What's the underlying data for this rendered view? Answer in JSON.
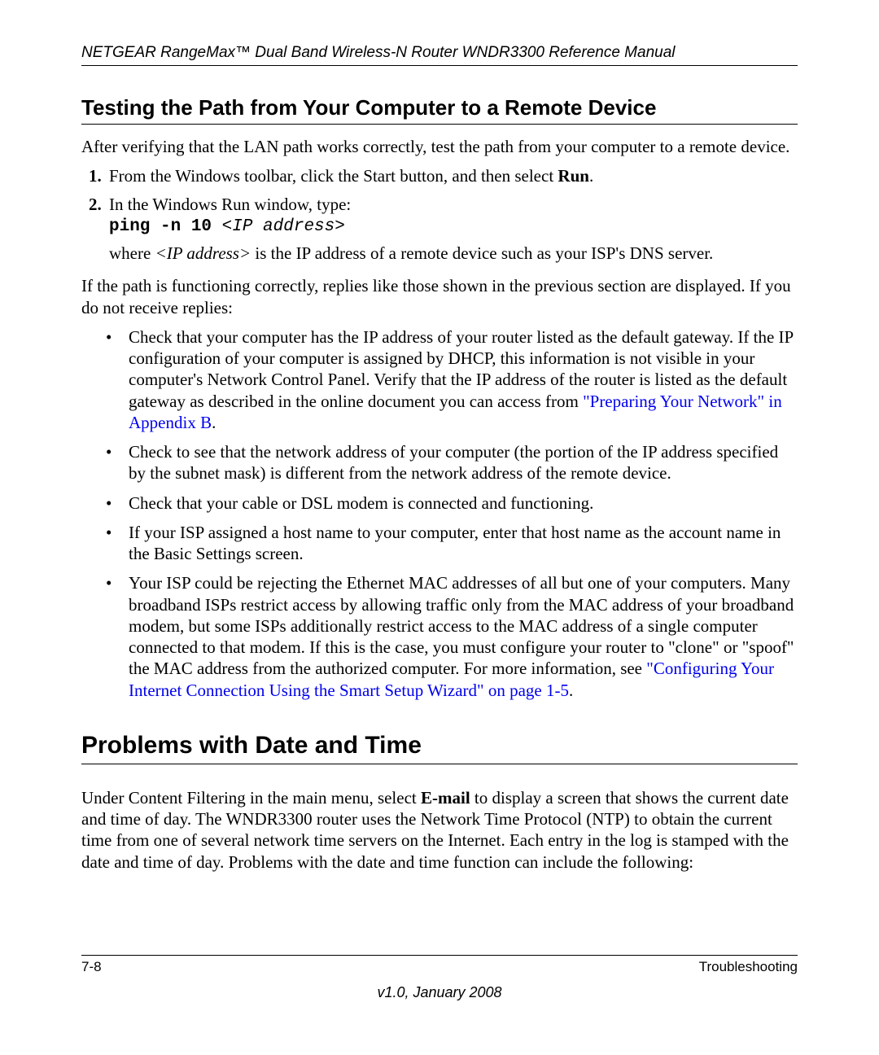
{
  "header": {
    "running": "NETGEAR RangeMax™ Dual Band Wireless-N Router WNDR3300 Reference Manual"
  },
  "section1": {
    "heading": "Testing the Path from Your Computer to a Remote Device",
    "intro": "After verifying that the LAN path works correctly, test the path from your computer to a remote device.",
    "steps": {
      "s1_a": "From the Windows toolbar, click the Start button, and then select ",
      "s1_b": "Run",
      "s1_c": ".",
      "s2_a": "In the Windows Run window, type:",
      "s2_code_bold": "ping -n 10 ",
      "s2_code_ital": "<IP address>",
      "s2_where_a": "where ",
      "s2_where_b": "<IP address>",
      "s2_where_c": " is the IP address of a remote device such as your ISP's DNS server."
    },
    "after_steps": "If the path is functioning correctly, replies like those shown in the previous section are displayed. If you do not receive replies:",
    "bullets": {
      "b1_a": "Check that your computer has the IP address of your router listed as the default gateway. If the IP configuration of your computer is assigned by DHCP, this information is not visible in your computer's Network Control Panel. Verify that the IP address of the router is listed as the default gateway as described in the online document you can access from ",
      "b1_link": "\"Preparing Your Network\" in Appendix B",
      "b1_b": ".",
      "b2": "Check to see that the network address of your computer (the portion of the IP address specified by the subnet mask) is different from the network address of the remote device.",
      "b3": "Check that your cable or DSL modem is connected and functioning.",
      "b4": "If your ISP assigned a host name to your computer, enter that host name as the account name in the Basic Settings screen.",
      "b5_a": "Your ISP could be rejecting the Ethernet MAC addresses of all but one of your computers. Many broadband ISPs restrict access by allowing traffic only from the MAC address of your broadband modem, but some ISPs additionally restrict access to the MAC address of a single computer connected to that modem. If this is the case, you must configure your router to \"clone\" or \"spoof\" the MAC address from the authorized computer. For more information, see ",
      "b5_link": "\"Configuring Your Internet Connection Using the Smart Setup Wizard\" on page 1-5",
      "b5_b": "."
    }
  },
  "section2": {
    "heading": "Problems with Date and Time",
    "body_a": "Under Content Filtering in the main menu, select ",
    "body_b": "E-mail",
    "body_c": " to display a screen that shows the current date and time of day. The WNDR3300 router uses the Network Time Protocol (NTP) to obtain the current time from one of several network time servers on the Internet. Each entry in the log is stamped with the date and time of day. Problems with the date and time function can include the following:"
  },
  "footer": {
    "page": "7-8",
    "section": "Troubleshooting",
    "version": "v1.0, January 2008"
  }
}
